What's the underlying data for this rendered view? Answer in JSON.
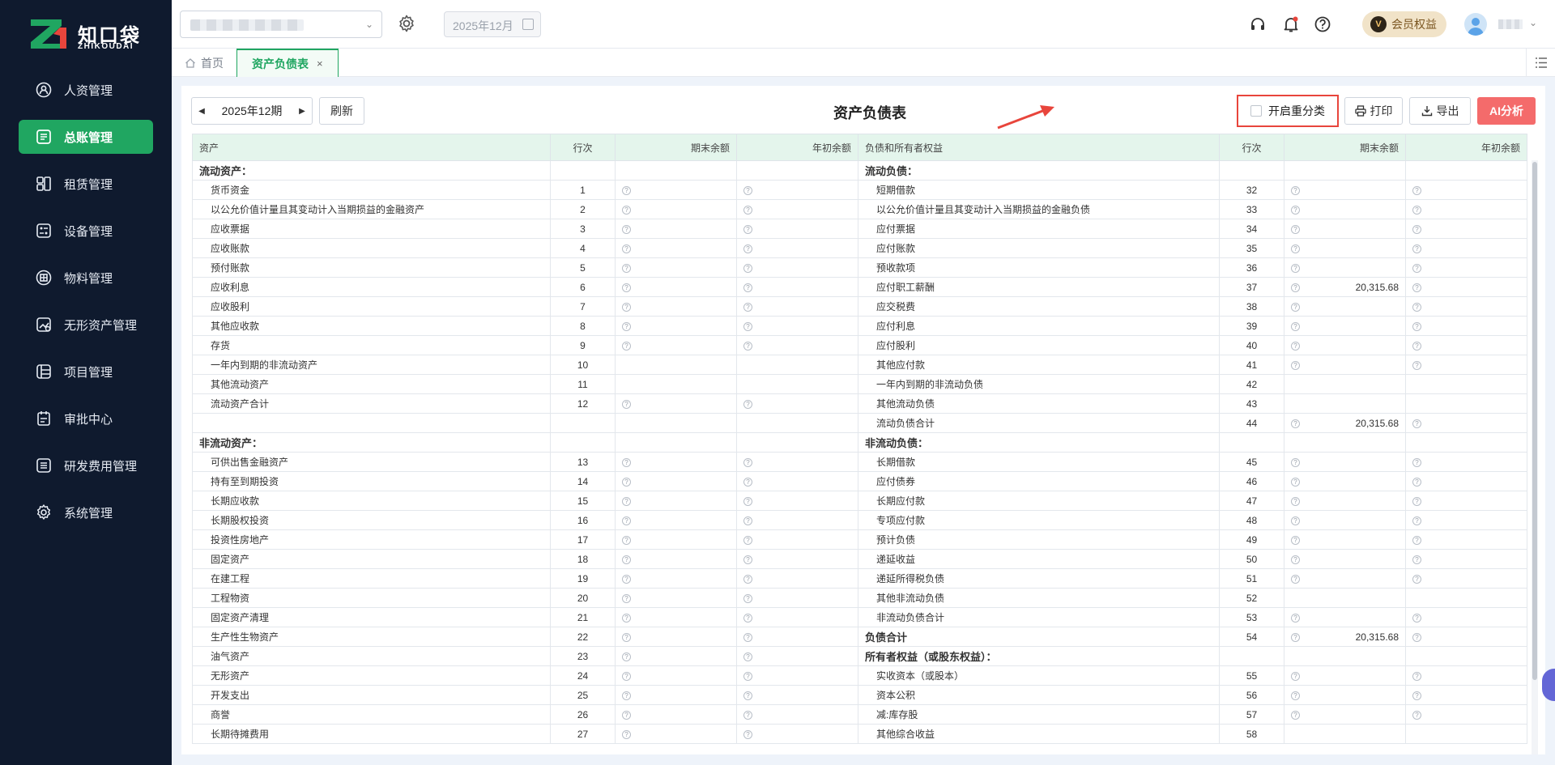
{
  "brand": {
    "name": "知口袋",
    "sub": "ZHIKOUDAI"
  },
  "sidebar": {
    "items": [
      {
        "label": "人资管理",
        "icon": "person-badge-icon",
        "active": false
      },
      {
        "label": "总账管理",
        "icon": "ledger-icon",
        "active": true
      },
      {
        "label": "租赁管理",
        "icon": "lease-icon",
        "active": false
      },
      {
        "label": "设备管理",
        "icon": "equipment-icon",
        "active": false
      },
      {
        "label": "物料管理",
        "icon": "materials-icon",
        "active": false
      },
      {
        "label": "无形资产管理",
        "icon": "intangible-asset-icon",
        "active": false
      },
      {
        "label": "项目管理",
        "icon": "project-icon",
        "active": false
      },
      {
        "label": "审批中心",
        "icon": "approval-icon",
        "active": false
      },
      {
        "label": "研发费用管理",
        "icon": "rd-expense-icon",
        "active": false
      },
      {
        "label": "系统管理",
        "icon": "gear-icon",
        "active": false
      }
    ]
  },
  "header": {
    "date_picker_value": "2025年12月",
    "member_label": "会员权益",
    "member_badge": "V"
  },
  "tabs": {
    "home_label": "首页",
    "active_label": "资产负债表",
    "close_glyph": "×"
  },
  "toolbar": {
    "period": "2025年12期",
    "refresh_label": "刷新",
    "title": "资产负债表",
    "reclass_label": "开启重分类",
    "print_label": "打印",
    "export_label": "导出",
    "ai_label": "AI分析"
  },
  "table": {
    "headers": [
      "资产",
      "行次",
      "期末余额",
      "年初余额",
      "负债和所有者权益",
      "行次",
      "期末余额",
      "年初余额"
    ],
    "rows": [
      {
        "l_name": "流动资产：",
        "l_sec": true,
        "l_line": "",
        "l_q": false,
        "r_name": "流动负债：",
        "r_sec": true,
        "r_line": "",
        "r_q": false,
        "r_end": ""
      },
      {
        "l_name": "货币资金",
        "l_line": "1",
        "l_q": true,
        "r_name": "短期借款",
        "r_line": "32",
        "r_q": true,
        "r_end": ""
      },
      {
        "l_name": "以公允价值计量且其变动计入当期损益的金融资产",
        "l_line": "2",
        "l_q": true,
        "r_name": "以公允价值计量且其变动计入当期损益的金融负债",
        "r_line": "33",
        "r_q": true,
        "r_end": ""
      },
      {
        "l_name": "应收票据",
        "l_line": "3",
        "l_q": true,
        "r_name": "应付票据",
        "r_line": "34",
        "r_q": true,
        "r_end": ""
      },
      {
        "l_name": "应收账款",
        "l_line": "4",
        "l_q": true,
        "r_name": "应付账款",
        "r_line": "35",
        "r_q": true,
        "r_end": ""
      },
      {
        "l_name": "预付账款",
        "l_line": "5",
        "l_q": true,
        "r_name": "预收款项",
        "r_line": "36",
        "r_q": true,
        "r_end": ""
      },
      {
        "l_name": "应收利息",
        "l_line": "6",
        "l_q": true,
        "r_name": "应付职工薪酬",
        "r_line": "37",
        "r_q": true,
        "r_end": "20,315.68"
      },
      {
        "l_name": "应收股利",
        "l_line": "7",
        "l_q": true,
        "r_name": "应交税费",
        "r_line": "38",
        "r_q": true,
        "r_end": ""
      },
      {
        "l_name": "其他应收款",
        "l_line": "8",
        "l_q": true,
        "r_name": "应付利息",
        "r_line": "39",
        "r_q": true,
        "r_end": ""
      },
      {
        "l_name": "存货",
        "l_line": "9",
        "l_q": true,
        "r_name": "应付股利",
        "r_line": "40",
        "r_q": true,
        "r_end": ""
      },
      {
        "l_name": "一年内到期的非流动资产",
        "l_line": "10",
        "l_q": false,
        "r_name": "其他应付款",
        "r_line": "41",
        "r_q": true,
        "r_end": ""
      },
      {
        "l_name": "其他流动资产",
        "l_line": "11",
        "l_q": false,
        "r_name": "一年内到期的非流动负债",
        "r_line": "42",
        "r_q": false,
        "r_end": ""
      },
      {
        "l_name": "流动资产合计",
        "l_line": "12",
        "l_q": true,
        "r_name": "其他流动负债",
        "r_line": "43",
        "r_q": false,
        "r_end": ""
      },
      {
        "l_name": "",
        "l_line": "",
        "l_q": false,
        "r_name": "流动负债合计",
        "r_line": "44",
        "r_q": true,
        "r_end": "20,315.68"
      },
      {
        "l_name": "非流动资产：",
        "l_sec": true,
        "l_line": "",
        "l_q": false,
        "r_name": "非流动负债：",
        "r_sec": true,
        "r_line": "",
        "r_q": false,
        "r_end": ""
      },
      {
        "l_name": "可供出售金融资产",
        "l_line": "13",
        "l_q": true,
        "r_name": "长期借款",
        "r_line": "45",
        "r_q": true,
        "r_end": ""
      },
      {
        "l_name": "持有至到期投资",
        "l_line": "14",
        "l_q": true,
        "r_name": "应付债券",
        "r_line": "46",
        "r_q": true,
        "r_end": ""
      },
      {
        "l_name": "长期应收款",
        "l_line": "15",
        "l_q": true,
        "r_name": "长期应付款",
        "r_line": "47",
        "r_q": true,
        "r_end": ""
      },
      {
        "l_name": "长期股权投资",
        "l_line": "16",
        "l_q": true,
        "r_name": "专项应付款",
        "r_line": "48",
        "r_q": true,
        "r_end": ""
      },
      {
        "l_name": "投资性房地产",
        "l_line": "17",
        "l_q": true,
        "r_name": "预计负债",
        "r_line": "49",
        "r_q": true,
        "r_end": ""
      },
      {
        "l_name": "固定资产",
        "l_line": "18",
        "l_q": true,
        "r_name": "递延收益",
        "r_line": "50",
        "r_q": true,
        "r_end": ""
      },
      {
        "l_name": "在建工程",
        "l_line": "19",
        "l_q": true,
        "r_name": "递延所得税负债",
        "r_line": "51",
        "r_q": true,
        "r_end": ""
      },
      {
        "l_name": "工程物资",
        "l_line": "20",
        "l_q": true,
        "r_name": "其他非流动负债",
        "r_line": "52",
        "r_q": false,
        "r_end": ""
      },
      {
        "l_name": "固定资产清理",
        "l_line": "21",
        "l_q": true,
        "r_name": "非流动负债合计",
        "r_line": "53",
        "r_q": true,
        "r_end": ""
      },
      {
        "l_name": "生产性生物资产",
        "l_line": "22",
        "l_q": true,
        "r_name": "负债合计",
        "r_sec": true,
        "r_line": "54",
        "r_q": true,
        "r_end": "20,315.68"
      },
      {
        "l_name": "油气资产",
        "l_line": "23",
        "l_q": true,
        "r_name": "所有者权益（或股东权益）：",
        "r_sec": true,
        "r_line": "",
        "r_q": false,
        "r_end": ""
      },
      {
        "l_name": "无形资产",
        "l_line": "24",
        "l_q": true,
        "r_name": "实收资本（或股本）",
        "r_line": "55",
        "r_q": true,
        "r_end": ""
      },
      {
        "l_name": "开发支出",
        "l_line": "25",
        "l_q": true,
        "r_name": "资本公积",
        "r_line": "56",
        "r_q": true,
        "r_end": ""
      },
      {
        "l_name": "商誉",
        "l_line": "26",
        "l_q": true,
        "r_name": "减:库存股",
        "r_line": "57",
        "r_q": true,
        "r_end": ""
      },
      {
        "l_name": "长期待摊费用",
        "l_line": "27",
        "l_q": true,
        "r_name": "其他综合收益",
        "r_line": "58",
        "r_q": false,
        "r_end": ""
      }
    ]
  },
  "colors": {
    "sidebar_bg": "#0f1a2e",
    "accent_green": "#20a661",
    "header_row_bg": "#e4f5ec",
    "ai_button": "#f46b6b",
    "highlight_red": "#e8453c"
  }
}
